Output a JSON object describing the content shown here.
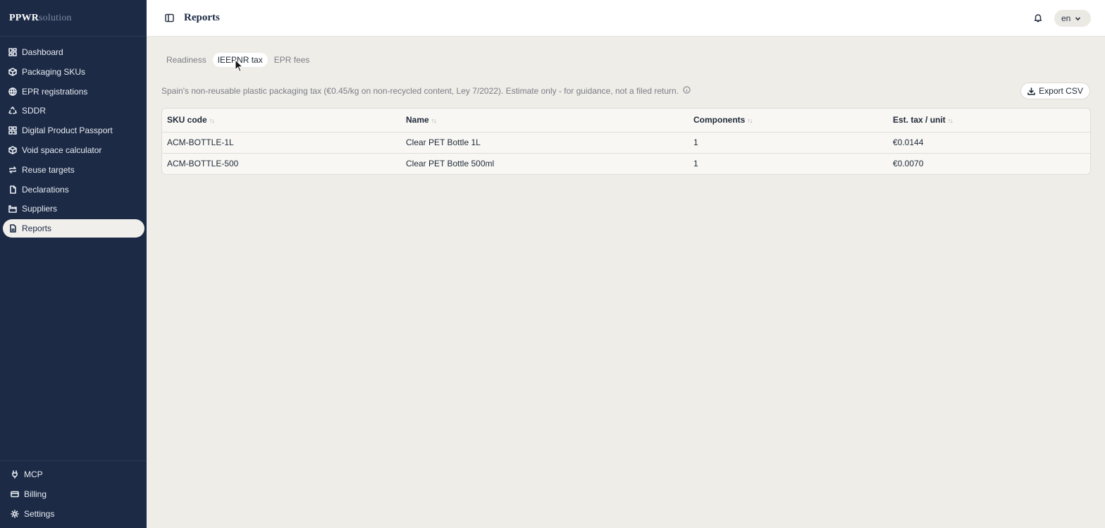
{
  "brand": {
    "part1": "PPWR",
    "part2": "solution"
  },
  "nav": [
    {
      "label": "Dashboard",
      "icon": "dashboard-icon"
    },
    {
      "label": "Packaging SKUs",
      "icon": "package-icon"
    },
    {
      "label": "EPR registrations",
      "icon": "globe-icon"
    },
    {
      "label": "SDDR",
      "icon": "recycle-icon"
    },
    {
      "label": "Digital Product Passport",
      "icon": "qr-code-icon"
    },
    {
      "label": "Void space calculator",
      "icon": "box-icon"
    },
    {
      "label": "Reuse targets",
      "icon": "repeat-icon"
    },
    {
      "label": "Declarations",
      "icon": "file-icon"
    },
    {
      "label": "Suppliers",
      "icon": "factory-icon"
    },
    {
      "label": "Reports",
      "icon": "report-icon",
      "active": true
    }
  ],
  "nav_bottom": [
    {
      "label": "MCP",
      "icon": "plug-icon"
    },
    {
      "label": "Billing",
      "icon": "credit-card-icon"
    },
    {
      "label": "Settings",
      "icon": "gear-icon"
    }
  ],
  "header": {
    "title": "Reports",
    "language": "en"
  },
  "tabs": [
    {
      "label": "Readiness"
    },
    {
      "label": "IEEPNR tax",
      "active": true
    },
    {
      "label": "EPR fees"
    }
  ],
  "description": "Spain's non-reusable plastic packaging tax (€0.45/kg on non-recycled content, Ley 7/2022). Estimate only - for guidance, not a filed return.",
  "export_label": "Export CSV",
  "table": {
    "columns": [
      "SKU code",
      "Name",
      "Components",
      "Est. tax / unit"
    ],
    "rows": [
      [
        "ACM-BOTTLE-1L",
        "Clear PET Bottle 1L",
        "1",
        "€0.0144"
      ],
      [
        "ACM-BOTTLE-500",
        "Clear PET Bottle 500ml",
        "1",
        "€0.0070"
      ]
    ]
  },
  "colors": {
    "sidebar_bg": "#1c2a45",
    "page_bg": "#efede8",
    "accent": "#1c2a45"
  }
}
